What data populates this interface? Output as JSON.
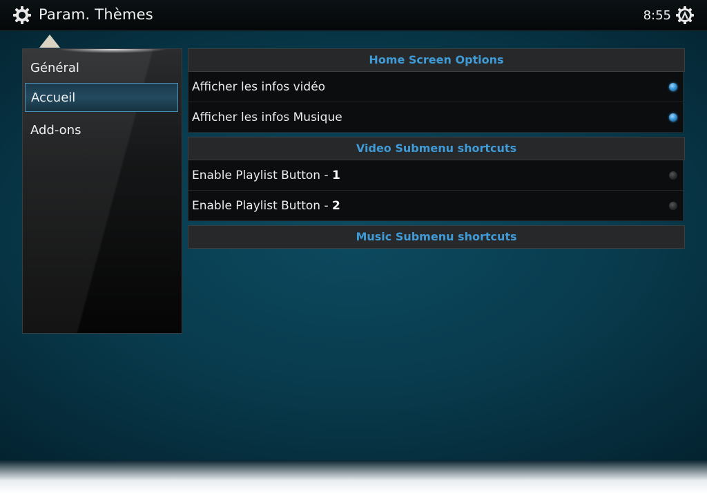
{
  "header": {
    "title": "Param. Thèmes",
    "clock": "8:55",
    "left_icon": "gear-icon",
    "right_icon": "kodi-logo-icon"
  },
  "sidebar": {
    "items": [
      {
        "label": "Général",
        "selected": false
      },
      {
        "label": "Accueil",
        "selected": true
      },
      {
        "label": "Add-ons",
        "selected": false
      }
    ]
  },
  "settings": {
    "sections": [
      {
        "title": "Home Screen Options",
        "rows": [
          {
            "label": "Afficher les infos vidéo",
            "num": "",
            "enabled": true
          },
          {
            "label": "Afficher les infos Musique",
            "num": "",
            "enabled": true
          }
        ]
      },
      {
        "title": "Video Submenu shortcuts",
        "rows": [
          {
            "label": "Enable Playlist Button - ",
            "num": "1",
            "enabled": false
          },
          {
            "label": "Enable Playlist Button - ",
            "num": "2",
            "enabled": false
          }
        ]
      },
      {
        "title": "Music Submenu shortcuts",
        "rows": []
      }
    ]
  },
  "colors": {
    "accent": "#3f9ad6",
    "background": "#083a4c"
  }
}
